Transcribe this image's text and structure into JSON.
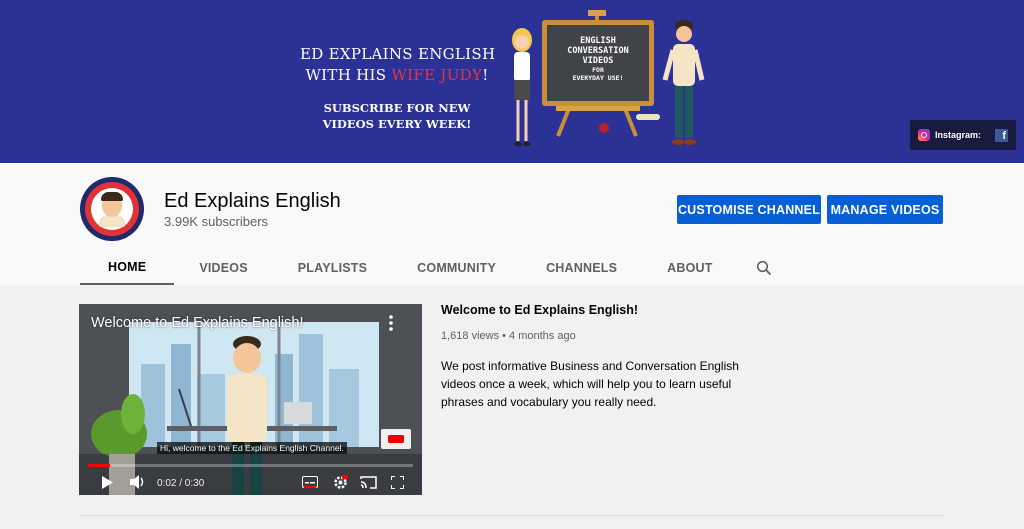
{
  "banner": {
    "title_line1": "ED EXPLAINS ENGLISH",
    "title_line2_pre": "WITH HIS ",
    "title_line2_highlight": "WIFE JUDY",
    "title_line2_post": "!",
    "subtitle_line1": "SUBSCRIBE FOR NEW",
    "subtitle_line2": "VIDEOS EVERY WEEK!",
    "board_line1": "ENGLISH",
    "board_line2": "CONVERSATION",
    "board_line3": "VIDEOS",
    "board_line4": "FOR",
    "board_line5": "EVERYDAY USE!",
    "social_label": "Instagram:",
    "facebook_glyph": "f"
  },
  "channel": {
    "name": "Ed Explains English",
    "subscribers": "3.99K subscribers",
    "customise_label": "CUSTOMISE CHANNEL",
    "manage_label": "MANAGE VIDEOS"
  },
  "tabs": [
    {
      "label": "HOME",
      "active": true
    },
    {
      "label": "VIDEOS"
    },
    {
      "label": "PLAYLISTS"
    },
    {
      "label": "COMMUNITY"
    },
    {
      "label": "CHANNELS"
    },
    {
      "label": "ABOUT"
    }
  ],
  "video": {
    "overlay_title": "Welcome to Ed Explains English!",
    "caption": "Hi, welcome to the Ed Explains English Channel.",
    "time": "0:02 / 0:30",
    "progress": 0.067
  },
  "featured": {
    "title": "Welcome to Ed Explains English!",
    "meta": "1,618 views • 4 months ago",
    "description": "We post informative Business and Conversation English videos once a week, which will help you to learn useful phrases and vocabulary you really need."
  },
  "colors": {
    "banner_bg": "#2c3196",
    "accent_blue": "#065fd4",
    "highlight_red": "#e8333f"
  }
}
